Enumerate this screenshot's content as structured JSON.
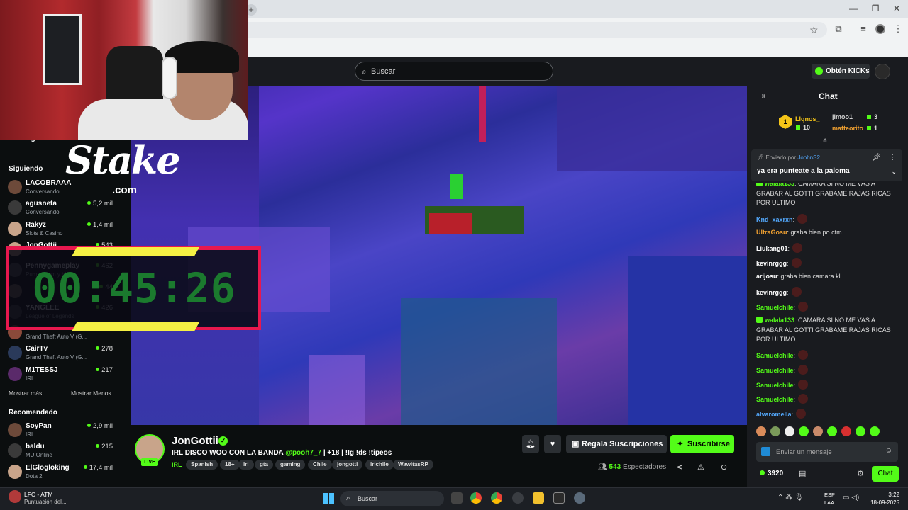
{
  "browser": {
    "new_tab": "+",
    "min": "—",
    "max": "❐",
    "close": "✕"
  },
  "header": {
    "search_placeholder": "Buscar",
    "kicks_label": "Obtén KICKs"
  },
  "sidebar": {
    "following_heading": "Siguiendo",
    "following_heading_partial": "Siguiendo",
    "following": [
      {
        "name": "LACOBRAAA",
        "sub": "Conversando",
        "viewers": ""
      },
      {
        "name": "agusneta",
        "sub": "Conversando",
        "viewers": "5,2 mil"
      },
      {
        "name": "Rakyz",
        "sub": "Slots & Casino",
        "viewers": "1,4 mil"
      },
      {
        "name": "JonGottii",
        "sub": "",
        "viewers": "543"
      },
      {
        "name": "Pennygameplay",
        "sub": "Pummi pom y bl...",
        "viewers": "462"
      },
      {
        "name": "",
        "sub": "",
        "viewers": "44"
      },
      {
        "name": "YANGLEE",
        "sub": "League of Legends",
        "viewers": "426"
      },
      {
        "name": "",
        "sub": "Grand Theft Auto V (G...",
        "viewers": ""
      },
      {
        "name": "CairTv",
        "sub": "Grand Theft Auto V (G...",
        "viewers": "278"
      },
      {
        "name": "M1TESSJ",
        "sub": "IRL",
        "viewers": "217"
      }
    ],
    "show_more": "Mostrar más",
    "show_less": "Mostrar Menos",
    "recommended_heading": "Recomendado",
    "recommended": [
      {
        "name": "SoyPan",
        "sub": "IRL",
        "viewers": "2,9 mil"
      },
      {
        "name": "baldu",
        "sub": "MU Online",
        "viewers": "215"
      },
      {
        "name": "ElGlogloking",
        "sub": "Dota 2",
        "viewers": "17,4 mil"
      }
    ]
  },
  "overlay": {
    "stake_word": "Stake",
    "stake_com": ".com",
    "timer": "00:45:26"
  },
  "stream": {
    "streamer": "JonGottii",
    "live_badge": "LIVE",
    "title_start": "IRL DISCO WOO CON LA BANDA ",
    "title_mention": "@pooh7_7",
    "title_end": " | +18 | !Ig !ds !tipeos",
    "category": "IRL",
    "tags": [
      "Spanish",
      "18+",
      "irl",
      "gta",
      "gaming",
      "Chile",
      "jongotti",
      "irlchile",
      "WawitasRP"
    ],
    "gift_label": "Regala Suscripciones",
    "subscribe_label": "Suscribirse",
    "viewers_count": "543",
    "viewers_label": "Espectadores"
  },
  "chat": {
    "title": "Chat",
    "leaderboard": [
      {
        "name": "Llqnos_",
        "value": "10",
        "color": "#f5c518"
      },
      {
        "name": "jimoo1",
        "value": "3",
        "color": "#cfcfcf"
      },
      {
        "name": "matteorito",
        "value": "1",
        "color": "#f0a030"
      }
    ],
    "rank_label": "1",
    "pinned_by_label": "Enviado por",
    "pinned_by_user": "JoohnS2",
    "pinned_message": "ya era punteate a la paloma",
    "messages": [
      {
        "user": "walala133",
        "text": ": CAMARA SI NO ME VAS A GRABAR AL GOTTI GRABAME RAJAS RICAS POR ULTIMO",
        "color": "#53fc18",
        "emote": false,
        "badge": true
      },
      {
        "user": "Knd_xaxrxn",
        "text": ":",
        "color": "#53a8fc",
        "emote": true,
        "badge": false
      },
      {
        "user": "UltraGosu",
        "text": ": graba bien po ctm",
        "color": "#f0a030",
        "emote": false,
        "badge": false
      },
      {
        "user": "Liukang01",
        "text": ":",
        "color": "#ffffff",
        "emote": true,
        "badge": false
      },
      {
        "user": "kevinrggg",
        "text": ":",
        "color": "#ffffff",
        "emote": true,
        "badge": false
      },
      {
        "user": "arijosu",
        "text": ": graba bien camara kl",
        "color": "#ffffff",
        "emote": false,
        "badge": false
      },
      {
        "user": "kevinrggg",
        "text": ":",
        "color": "#ffffff",
        "emote": true,
        "badge": false
      },
      {
        "user": "Samuelchile",
        "text": ":",
        "color": "#53fc18",
        "emote": true,
        "badge": false
      },
      {
        "user": "walala133",
        "text": ": CAMARA SI NO ME VAS A GRABAR AL GOTTI GRABAME RAJAS RICAS POR ULTIMO",
        "color": "#53fc18",
        "emote": false,
        "badge": true
      },
      {
        "user": "Samuelchile",
        "text": ":",
        "color": "#53fc18",
        "emote": true,
        "badge": false
      },
      {
        "user": "Samuelchile",
        "text": ":",
        "color": "#53fc18",
        "emote": true,
        "badge": false
      },
      {
        "user": "Samuelchile",
        "text": ":",
        "color": "#53fc18",
        "emote": true,
        "badge": false
      },
      {
        "user": "Samuelchile",
        "text": ":",
        "color": "#53fc18",
        "emote": true,
        "badge": false
      },
      {
        "user": "alvaromella",
        "text": ":",
        "color": "#53a8fc",
        "emote": true,
        "badge": false
      }
    ],
    "input_placeholder": "Enviar un mensaje",
    "points": "3920",
    "chat_button": "Chat"
  },
  "taskbar": {
    "weather_title": "LFC - ATM",
    "weather_sub": "Puntuación del...",
    "search_label": "Buscar",
    "lang_1": "ESP",
    "lang_2": "LAA",
    "time": "3:22",
    "date": "18-09-2025"
  },
  "colors": {
    "kick_green": "#53fc18",
    "timer_border": "#e8184e",
    "timer_bars": "#f5f044"
  }
}
